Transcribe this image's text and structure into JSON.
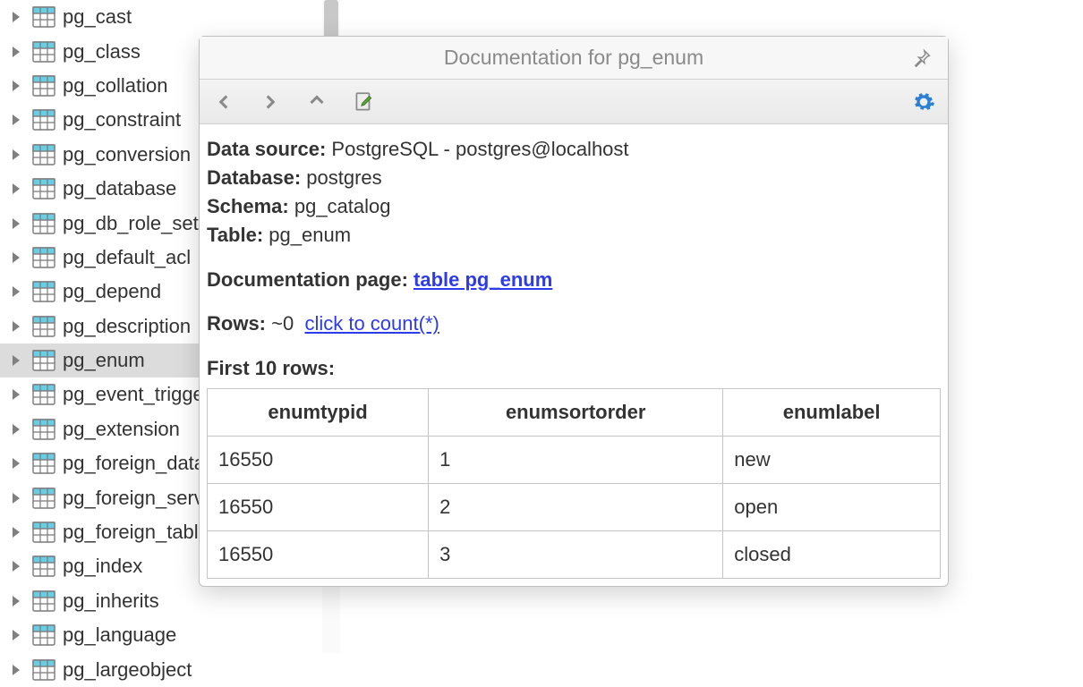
{
  "tree": {
    "items": [
      {
        "label": "pg_cast"
      },
      {
        "label": "pg_class"
      },
      {
        "label": "pg_collation"
      },
      {
        "label": "pg_constraint"
      },
      {
        "label": "pg_conversion"
      },
      {
        "label": "pg_database"
      },
      {
        "label": "pg_db_role_setting"
      },
      {
        "label": "pg_default_acl"
      },
      {
        "label": "pg_depend"
      },
      {
        "label": "pg_description"
      },
      {
        "label": "pg_enum"
      },
      {
        "label": "pg_event_trigger"
      },
      {
        "label": "pg_extension"
      },
      {
        "label": "pg_foreign_data_wrap"
      },
      {
        "label": "pg_foreign_server"
      },
      {
        "label": "pg_foreign_table"
      },
      {
        "label": "pg_index"
      },
      {
        "label": "pg_inherits"
      },
      {
        "label": "pg_language"
      },
      {
        "label": "pg_largeobject"
      }
    ],
    "selected_index": 10
  },
  "popup": {
    "title": "Documentation for pg_enum",
    "labels": {
      "data_source": "Data source:",
      "database": "Database:",
      "schema": "Schema:",
      "table": "Table:",
      "doc_page": "Documentation page:",
      "rows": "Rows:",
      "first_rows": "First 10 rows:"
    },
    "data_source": "PostgreSQL - postgres@localhost",
    "database": "postgres",
    "schema": "pg_catalog",
    "table": "pg_enum",
    "doc_link_text": "table pg_enum",
    "rows_approx": "~0",
    "count_link": "click to count(*)",
    "columns": [
      "enumtypid",
      "enumsortorder",
      "enumlabel"
    ],
    "data": [
      [
        "16550",
        "1",
        "new"
      ],
      [
        "16550",
        "2",
        "open"
      ],
      [
        "16550",
        "3",
        "closed"
      ]
    ]
  }
}
